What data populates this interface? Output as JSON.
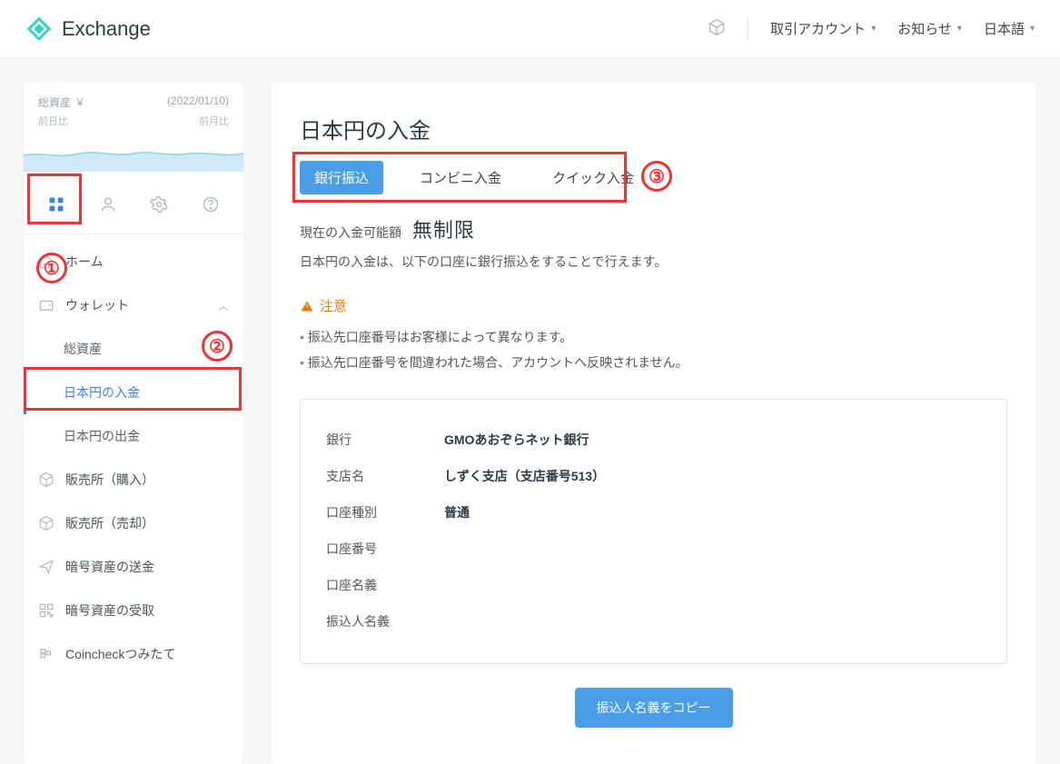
{
  "header": {
    "brand": "Exchange",
    "menu_account": "取引アカウント",
    "menu_notice": "お知らせ",
    "menu_lang": "日本語"
  },
  "sidebar": {
    "total_label": "総資産",
    "currency": "¥",
    "date": "(2022/01/10)",
    "prev_day": "前日比",
    "prev_month": "前月比",
    "nav": {
      "home": "ホーム",
      "wallet": "ウォレット",
      "sub_total": "総資産",
      "sub_deposit": "日本円の入金",
      "sub_withdraw": "日本円の出金",
      "buy": "販売所（購入）",
      "sell": "販売所（売却）",
      "send": "暗号資産の送金",
      "receive": "暗号資産の受取",
      "tsumitate": "Coincheckつみたて"
    }
  },
  "main": {
    "title": "日本円の入金",
    "tabs": {
      "bank": "銀行振込",
      "conv": "コンビニ入金",
      "quick": "クイック入金"
    },
    "limit_label": "現在の入金可能額",
    "limit_value": "無制限",
    "desc": "日本円の入金は、以下の口座に銀行振込をすることで行えます。",
    "warn_title": "注意",
    "warn1": "振込先口座番号はお客様によって異なります。",
    "warn2": "振込先口座番号を間違われた場合、アカウントへ反映されません。",
    "bank": {
      "bank_l": "銀行",
      "bank_v": "GMOあおぞらネット銀行",
      "branch_l": "支店名",
      "branch_v": "しずく支店（支店番号513）",
      "type_l": "口座種別",
      "type_v": "普通",
      "number_l": "口座番号",
      "number_v": "",
      "holder_l": "口座名義",
      "holder_v": "",
      "payer_l": "振込人名義",
      "payer_v": ""
    },
    "copy_button": "振込人名義をコピー"
  },
  "annotations": {
    "n1": "①",
    "n2": "②",
    "n3": "③"
  }
}
